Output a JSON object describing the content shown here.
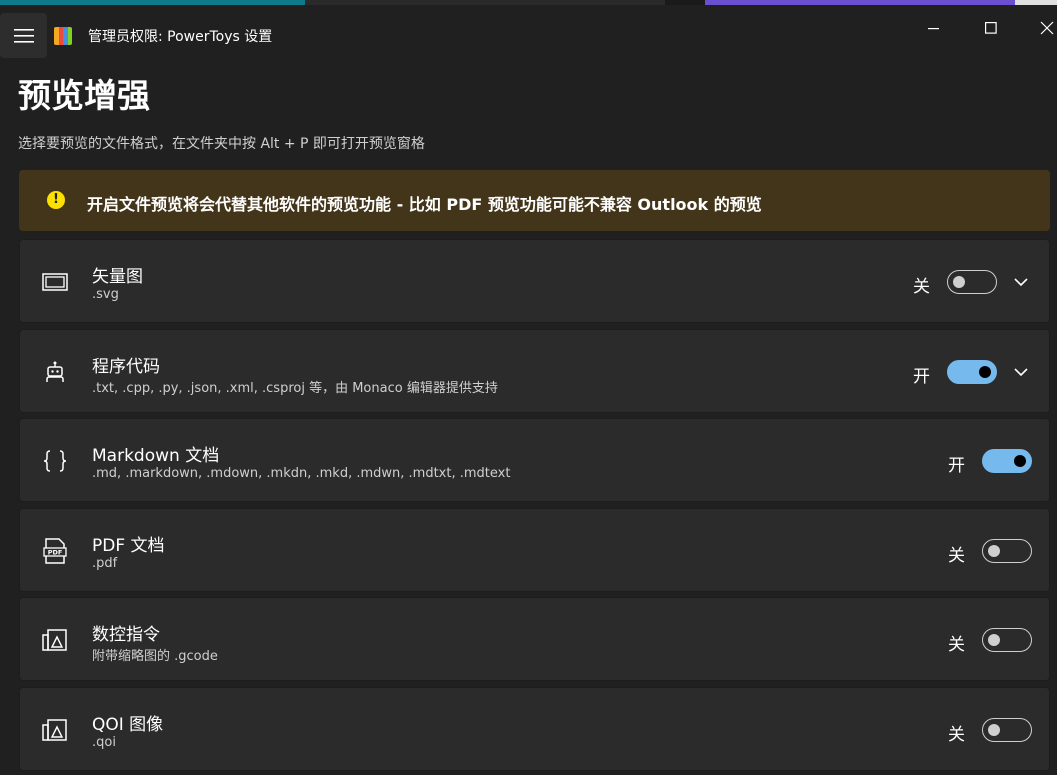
{
  "window": {
    "title": "管理员权限: PowerToys 设置"
  },
  "page": {
    "title": "预览增强",
    "description": "选择要预览的文件格式，在文件夹中按 Alt + P 即可打开预览窗格"
  },
  "warning": {
    "text": "开启文件预览将会代替其他软件的预览功能 - 比如 PDF 预览功能可能不兼容 Outlook 的预览",
    "color": "#fce100"
  },
  "accent_color": "#76b9ed",
  "items": [
    {
      "title": "矢量图",
      "subtitle": ".svg",
      "state_label": "关",
      "enabled": false,
      "expandable": true,
      "icon": "image-frame-icon"
    },
    {
      "title": "程序代码",
      "subtitle": ".txt, .cpp, .py, .json, .xml, .csproj 等，由 Monaco 编辑器提供支持",
      "state_label": "开",
      "enabled": true,
      "expandable": true,
      "icon": "robot-icon"
    },
    {
      "title": "Markdown 文档",
      "subtitle": ".md, .markdown, .mdown, .mkdn, .mkd, .mdwn, .mdtxt, .mdtext",
      "state_label": "开",
      "enabled": true,
      "expandable": false,
      "icon": "braces-icon"
    },
    {
      "title": "PDF 文档",
      "subtitle": ".pdf",
      "state_label": "关",
      "enabled": false,
      "expandable": false,
      "icon": "pdf-file-icon"
    },
    {
      "title": "数控指令",
      "subtitle": "附带缩略图的 .gcode",
      "state_label": "关",
      "enabled": false,
      "expandable": false,
      "icon": "image-preview-icon"
    },
    {
      "title": "QOI 图像",
      "subtitle": ".qoi",
      "state_label": "关",
      "enabled": false,
      "expandable": false,
      "icon": "image-preview-icon"
    }
  ]
}
